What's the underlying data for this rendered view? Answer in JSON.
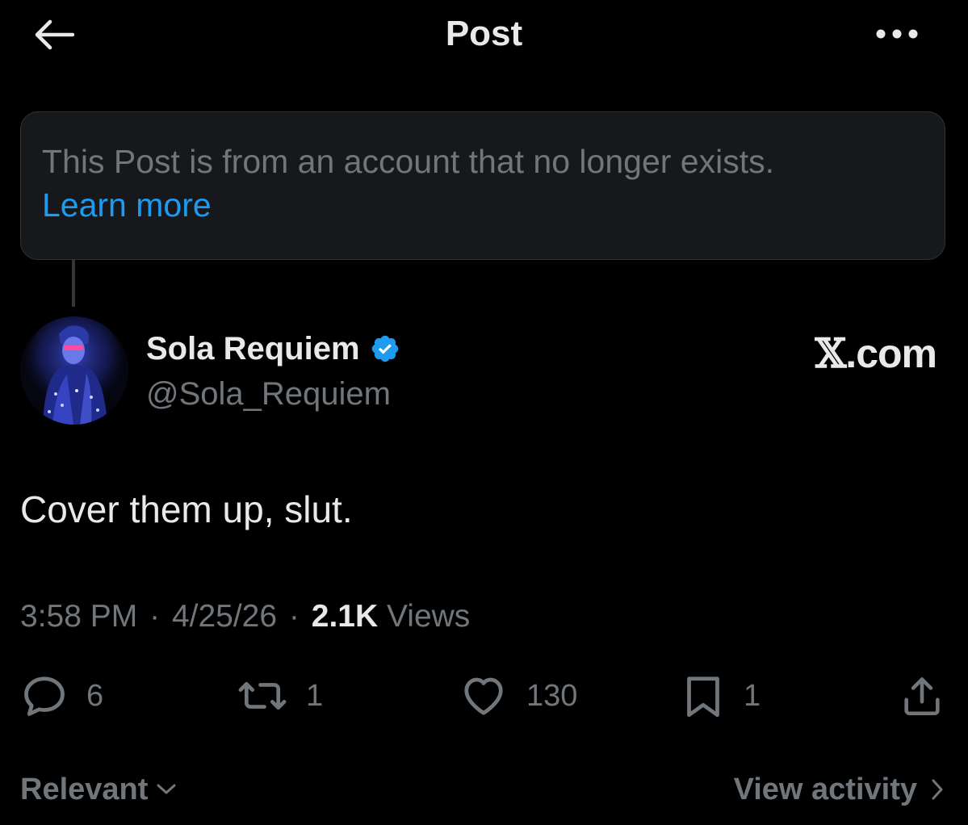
{
  "header": {
    "title": "Post",
    "back_icon": "arrow-left-icon",
    "more_icon": "more-dots-icon"
  },
  "notice": {
    "text": "This Post is from an account that no longer exists.",
    "link_label": "Learn more"
  },
  "post": {
    "author": {
      "display_name": "Sola Requiem",
      "handle": "@Sola_Requiem",
      "verified": true,
      "avatar_icon": "avatar-image"
    },
    "source_badge": {
      "glyph": "𝕏",
      "text": ".com"
    },
    "text": "Cover them up, slut.",
    "meta": {
      "time": "3:58 PM",
      "date": "4/25/26",
      "views_count": "2.1K",
      "views_label": "Views",
      "separator": "·"
    },
    "actions": {
      "replies": "6",
      "reposts": "1",
      "likes": "130",
      "bookmarks": "1"
    }
  },
  "footer": {
    "sort_label": "Relevant",
    "activity_label": "View activity"
  },
  "colors": {
    "background": "#000000",
    "text_primary": "#e7e9ea",
    "text_secondary": "#71767b",
    "link": "#1d9bf0",
    "notice_bg": "#16181c",
    "verified": "#1d9bf0"
  }
}
